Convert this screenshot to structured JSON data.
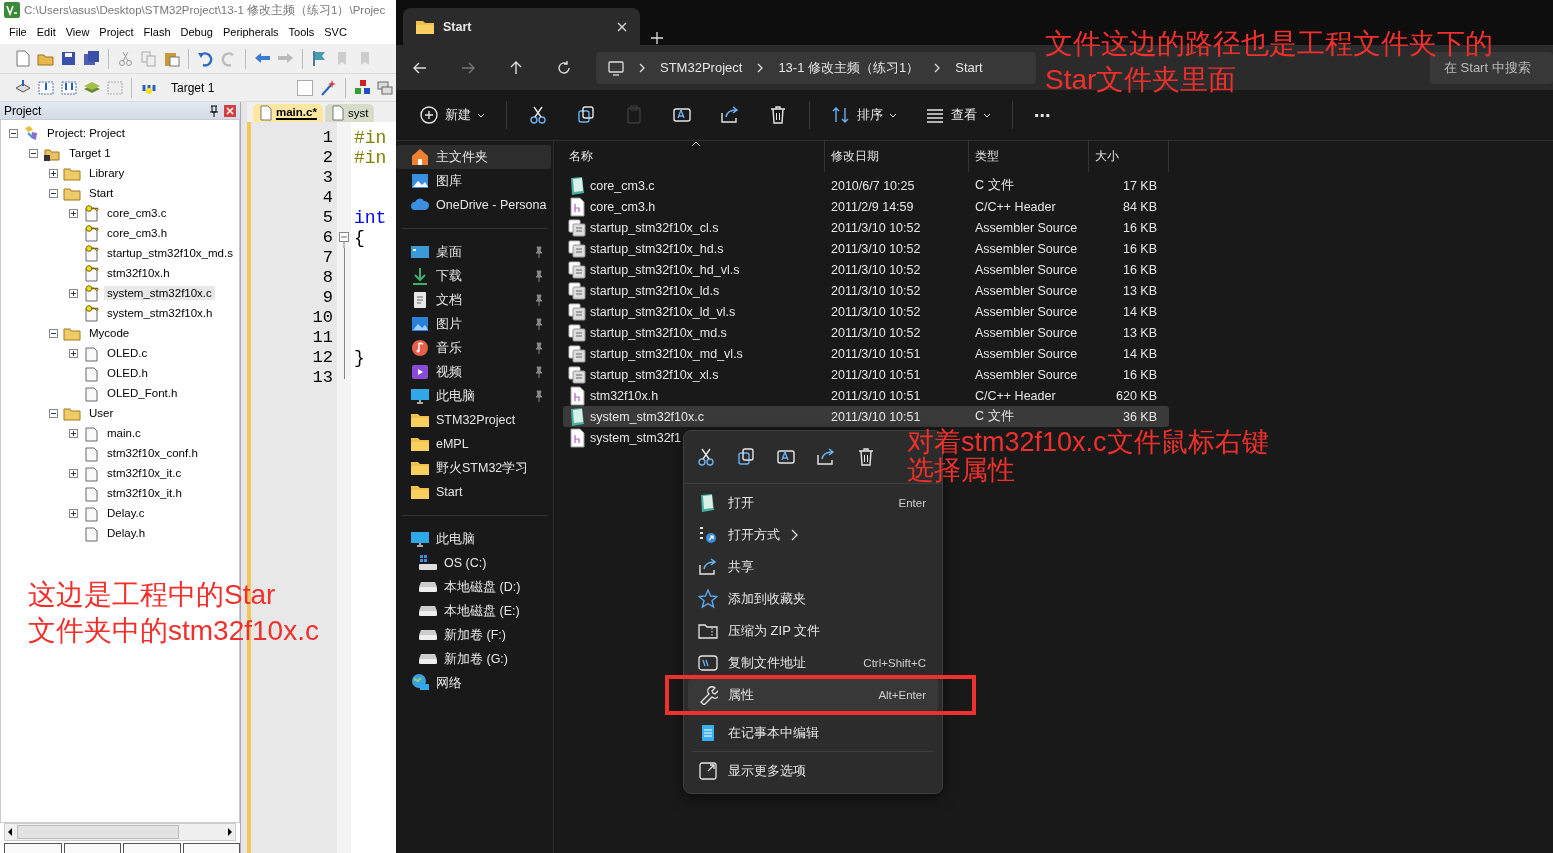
{
  "keil": {
    "title": "C:\\Users\\asus\\Desktop\\STM32Project\\13-1 修改主频（练习1）\\Projec",
    "menu": [
      "File",
      "Edit",
      "View",
      "Project",
      "Flash",
      "Debug",
      "Peripherals",
      "Tools",
      "SVC"
    ],
    "target": "Target 1",
    "project_panel": {
      "title": "Project",
      "tree": [
        {
          "label": "Project: Project",
          "kind": "project",
          "expandable": true,
          "expanded": true,
          "selected": false,
          "children": [
            {
              "label": "Target 1",
              "kind": "target",
              "expandable": true,
              "expanded": true,
              "selected": false,
              "children": [
                {
                  "label": "Library",
                  "kind": "folder",
                  "expandable": true,
                  "expanded": false,
                  "selected": false
                },
                {
                  "label": "Start",
                  "kind": "folder",
                  "expandable": true,
                  "expanded": true,
                  "selected": false,
                  "children": [
                    {
                      "label": "core_cm3.c",
                      "kind": "file",
                      "locked": true,
                      "expandable": true,
                      "expanded": false,
                      "selected": false
                    },
                    {
                      "label": "core_cm3.h",
                      "kind": "file",
                      "locked": true,
                      "expandable": false,
                      "selected": false
                    },
                    {
                      "label": "startup_stm32f10x_md.s",
                      "kind": "file",
                      "locked": true,
                      "expandable": false,
                      "selected": false
                    },
                    {
                      "label": "stm32f10x.h",
                      "kind": "file",
                      "locked": true,
                      "expandable": false,
                      "selected": false
                    },
                    {
                      "label": "system_stm32f10x.c",
                      "kind": "file",
                      "locked": true,
                      "expandable": true,
                      "expanded": false,
                      "selected": true
                    },
                    {
                      "label": "system_stm32f10x.h",
                      "kind": "file",
                      "locked": true,
                      "expandable": false,
                      "selected": false
                    }
                  ]
                },
                {
                  "label": "Mycode",
                  "kind": "folder",
                  "expandable": true,
                  "expanded": true,
                  "selected": false,
                  "children": [
                    {
                      "label": "OLED.c",
                      "kind": "file",
                      "locked": false,
                      "expandable": true,
                      "expanded": false,
                      "selected": false
                    },
                    {
                      "label": "OLED.h",
                      "kind": "file",
                      "locked": false,
                      "expandable": false,
                      "selected": false
                    },
                    {
                      "label": "OLED_Font.h",
                      "kind": "file",
                      "locked": false,
                      "expandable": false,
                      "selected": false
                    }
                  ]
                },
                {
                  "label": "User",
                  "kind": "folder",
                  "expandable": true,
                  "expanded": true,
                  "selected": false,
                  "children": [
                    {
                      "label": "main.c",
                      "kind": "file",
                      "locked": false,
                      "expandable": true,
                      "expanded": false,
                      "selected": false
                    },
                    {
                      "label": "stm32f10x_conf.h",
                      "kind": "file",
                      "locked": false,
                      "expandable": false,
                      "selected": false
                    },
                    {
                      "label": "stm32f10x_it.c",
                      "kind": "file",
                      "locked": false,
                      "expandable": true,
                      "expanded": false,
                      "selected": false
                    },
                    {
                      "label": "stm32f10x_it.h",
                      "kind": "file",
                      "locked": false,
                      "expandable": false,
                      "selected": false
                    },
                    {
                      "label": "Delay.c",
                      "kind": "file",
                      "locked": false,
                      "expandable": true,
                      "expanded": false,
                      "selected": false
                    },
                    {
                      "label": "Delay.h",
                      "kind": "file",
                      "locked": false,
                      "expandable": false,
                      "selected": false
                    }
                  ]
                }
              ]
            }
          ]
        }
      ]
    },
    "editor": {
      "tabs": [
        {
          "label": "main.c*",
          "selected": true
        },
        {
          "label": "syst",
          "selected": false
        }
      ],
      "lines": [
        {
          "number": "1",
          "code": "#in",
          "kind": "preprocessor",
          "in_block": false
        },
        {
          "number": "2",
          "code": "#in",
          "kind": "preprocessor",
          "in_block": false
        },
        {
          "number": "3",
          "in_block": false
        },
        {
          "number": "4",
          "in_block": false
        },
        {
          "number": "5",
          "code": "int",
          "kind": "keyword",
          "in_block": false
        },
        {
          "number": "6",
          "code": "{",
          "kind": "plain",
          "in_block": true
        },
        {
          "number": "7",
          "in_block": true
        },
        {
          "number": "8",
          "in_block": true
        },
        {
          "number": "9",
          "in_block": true
        },
        {
          "number": "10",
          "in_block": true
        },
        {
          "number": "11",
          "in_block": true
        },
        {
          "number": "12",
          "code": "}",
          "kind": "plain",
          "in_block": true
        },
        {
          "number": "13",
          "in_block": true
        }
      ]
    }
  },
  "explorer": {
    "tab": {
      "title": "Start"
    },
    "breadcrumb": [
      "STM32Project",
      "13-1 修改主频（练习1）",
      "Start"
    ],
    "search": {
      "placeholder": "在 Start 中搜索"
    },
    "commands": [
      {
        "kind": "new",
        "label": "新建",
        "disabled": false
      },
      {
        "kind": "cut",
        "disabled": false
      },
      {
        "kind": "copy",
        "disabled": false
      },
      {
        "kind": "paste",
        "disabled": true
      },
      {
        "kind": "rename",
        "disabled": false
      },
      {
        "kind": "share",
        "disabled": false
      },
      {
        "kind": "delete",
        "disabled": false
      },
      {
        "kind": "sort",
        "label": "排序",
        "disabled": false
      },
      {
        "kind": "view",
        "label": "查看",
        "disabled": false
      },
      {
        "kind": "more",
        "label": "⋯",
        "disabled": false
      }
    ],
    "sidebar": [
      {
        "items": [
          {
            "label": "主文件夹",
            "kind": "home",
            "selected": true
          },
          {
            "label": "图库",
            "kind": "gallery",
            "selected": false
          },
          {
            "label": "OneDrive - Persona",
            "kind": "cloud",
            "selected": false
          }
        ]
      },
      {
        "items": [
          {
            "label": "桌面",
            "kind": "desktop",
            "pinned": true,
            "selected": false
          },
          {
            "label": "下载",
            "kind": "download",
            "pinned": true,
            "selected": false
          },
          {
            "label": "文档",
            "kind": "document",
            "pinned": true,
            "selected": false
          },
          {
            "label": "图片",
            "kind": "picture",
            "pinned": true,
            "selected": false
          },
          {
            "label": "音乐",
            "kind": "music",
            "pinned": true,
            "selected": false
          },
          {
            "label": "视频",
            "kind": "video",
            "pinned": true,
            "selected": false
          },
          {
            "label": "此电脑",
            "kind": "pc",
            "pinned": true,
            "selected": false
          },
          {
            "label": "STM32Project",
            "kind": "folder",
            "pinned": false,
            "selected": false
          },
          {
            "label": "eMPL",
            "kind": "folder",
            "pinned": false,
            "selected": false
          },
          {
            "label": "野火STM32学习",
            "kind": "folder",
            "pinned": false,
            "selected": false
          },
          {
            "label": "Start",
            "kind": "folder",
            "pinned": false,
            "selected": false
          }
        ]
      },
      {
        "items": [
          {
            "label": "此电脑",
            "kind": "pc",
            "selected": false,
            "children": [
              {
                "label": "OS (C:)",
                "kind": "os-drive",
                "selected": false
              },
              {
                "label": "本地磁盘 (D:)",
                "kind": "drive",
                "selected": false
              },
              {
                "label": "本地磁盘 (E:)",
                "kind": "drive",
                "selected": false
              },
              {
                "label": "新加卷 (F:)",
                "kind": "drive",
                "selected": false
              },
              {
                "label": "新加卷 (G:)",
                "kind": "drive",
                "selected": false
              }
            ]
          },
          {
            "label": "网络",
            "kind": "network",
            "selected": false
          }
        ]
      }
    ],
    "columns": [
      "名称",
      "修改日期",
      "类型",
      "大小"
    ],
    "files": [
      {
        "name": "core_cm3.c",
        "date": "2010/6/7 10:25",
        "type": "C 文件",
        "size": "17 KB",
        "kind": "c",
        "selected": false
      },
      {
        "name": "core_cm3.h",
        "date": "2011/2/9 14:59",
        "type": "C/C++ Header",
        "size": "84 KB",
        "kind": "h",
        "selected": false
      },
      {
        "name": "startup_stm32f10x_cl.s",
        "date": "2011/3/10 10:52",
        "type": "Assembler Source",
        "size": "16 KB",
        "kind": "asm",
        "selected": false
      },
      {
        "name": "startup_stm32f10x_hd.s",
        "date": "2011/3/10 10:52",
        "type": "Assembler Source",
        "size": "16 KB",
        "kind": "asm",
        "selected": false
      },
      {
        "name": "startup_stm32f10x_hd_vl.s",
        "date": "2011/3/10 10:52",
        "type": "Assembler Source",
        "size": "16 KB",
        "kind": "asm",
        "selected": false
      },
      {
        "name": "startup_stm32f10x_ld.s",
        "date": "2011/3/10 10:52",
        "type": "Assembler Source",
        "size": "13 KB",
        "kind": "asm",
        "selected": false
      },
      {
        "name": "startup_stm32f10x_ld_vl.s",
        "date": "2011/3/10 10:52",
        "type": "Assembler Source",
        "size": "14 KB",
        "kind": "asm",
        "selected": false
      },
      {
        "name": "startup_stm32f10x_md.s",
        "date": "2011/3/10 10:52",
        "type": "Assembler Source",
        "size": "13 KB",
        "kind": "asm",
        "selected": false
      },
      {
        "name": "startup_stm32f10x_md_vl.s",
        "date": "2011/3/10 10:51",
        "type": "Assembler Source",
        "size": "14 KB",
        "kind": "asm",
        "selected": false
      },
      {
        "name": "startup_stm32f10x_xl.s",
        "date": "2011/3/10 10:51",
        "type": "Assembler Source",
        "size": "16 KB",
        "kind": "asm",
        "selected": false
      },
      {
        "name": "stm32f10x.h",
        "date": "2011/3/10 10:51",
        "type": "C/C++ Header",
        "size": "620 KB",
        "kind": "h",
        "selected": false
      },
      {
        "name": "system_stm32f10x.c",
        "date": "2011/3/10 10:51",
        "type": "C 文件",
        "size": "36 KB",
        "kind": "c",
        "selected": true
      },
      {
        "name": "system_stm32f1",
        "kind": "h",
        "selected": false
      }
    ]
  },
  "context_menu": {
    "quick_actions": [
      {
        "kind": "cut"
      },
      {
        "kind": "copy"
      },
      {
        "kind": "rename"
      },
      {
        "kind": "share"
      },
      {
        "kind": "delete"
      }
    ],
    "sections": [
      {
        "items": [
          {
            "label": "打开",
            "kind": "open",
            "shortcut": "Enter",
            "submenu": false,
            "hovered": false,
            "highlighted": false
          },
          {
            "label": "打开方式",
            "kind": "open-with",
            "submenu": true,
            "hovered": false,
            "highlighted": false
          },
          {
            "label": "共享",
            "kind": "share",
            "submenu": false,
            "hovered": false,
            "highlighted": false
          },
          {
            "label": "添加到收藏夹",
            "kind": "star",
            "submenu": false,
            "hovered": false,
            "highlighted": false
          },
          {
            "label": "压缩为 ZIP 文件",
            "kind": "zip",
            "submenu": false,
            "hovered": false,
            "highlighted": false
          },
          {
            "label": "复制文件地址",
            "kind": "path",
            "shortcut": "Ctrl+Shift+C",
            "submenu": false,
            "hovered": false,
            "highlighted": false
          },
          {
            "label": "属性",
            "kind": "wrench",
            "shortcut": "Alt+Enter",
            "submenu": false,
            "hovered": true,
            "highlighted": true
          }
        ]
      },
      {
        "items": [
          {
            "label": "在记事本中编辑",
            "kind": "notepad",
            "submenu": false,
            "hovered": false,
            "highlighted": false
          }
        ]
      },
      {
        "items": [
          {
            "label": "显示更多选项",
            "kind": "more-options",
            "submenu": false,
            "hovered": false,
            "highlighted": false
          }
        ]
      }
    ]
  },
  "annotations": [
    {
      "lines": [
        "文件这边的路径也是工程文件夹下的",
        "Star文件夹里面"
      ]
    },
    {
      "lines": [
        "对着stm32f10x.c文件鼠标右键",
        "选择属性"
      ]
    },
    {
      "lines": [
        "这边是工程中的Star",
        "文件夹中的stm32f10x.c"
      ]
    }
  ]
}
